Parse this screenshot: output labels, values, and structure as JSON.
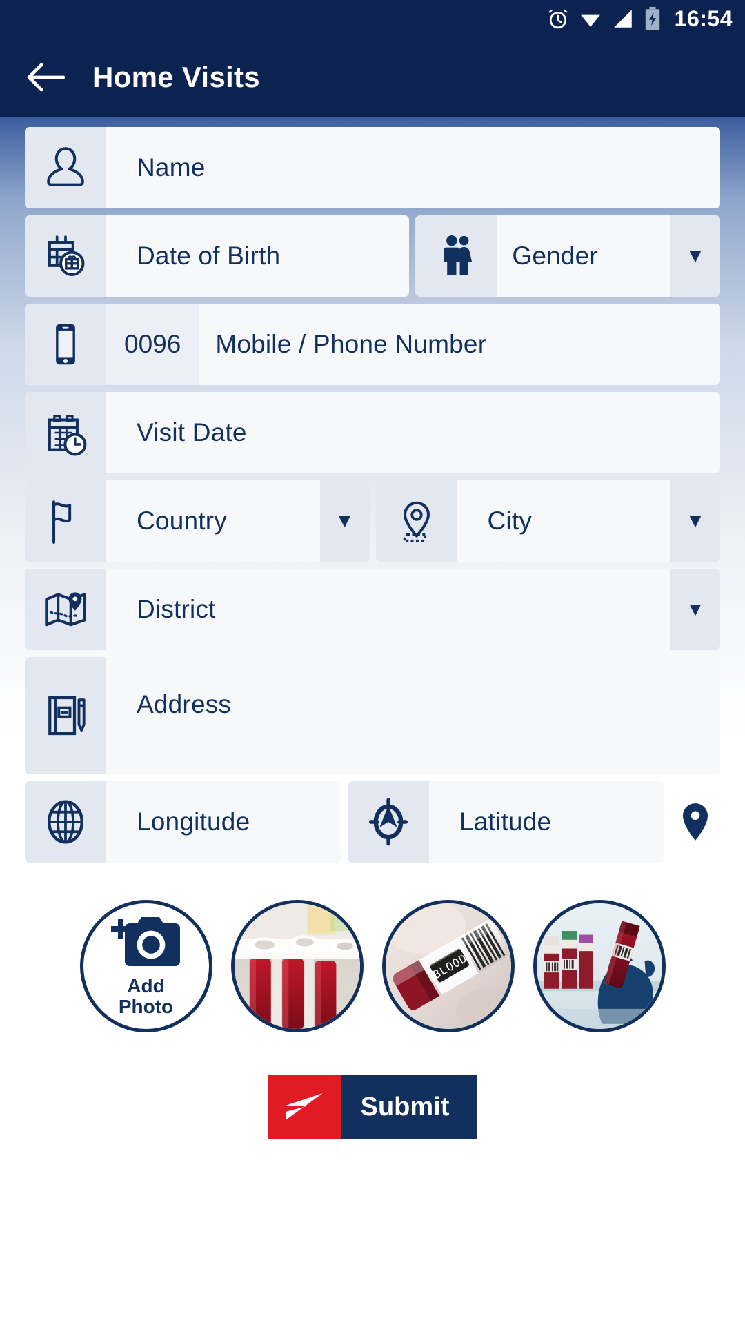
{
  "status_bar": {
    "time": "16:54",
    "icons": [
      "alarm-clock-icon",
      "wifi-icon",
      "cellular-signal-icon",
      "battery-charging-icon"
    ]
  },
  "app_bar": {
    "back_icon": "back-arrow-icon",
    "title": "Home Visits"
  },
  "form": {
    "fields": [
      {
        "key": "name",
        "label": "Name",
        "icon": "person-icon"
      },
      {
        "key": "dob",
        "label": "Date of Birth",
        "icon": "calendar-birthday-icon"
      },
      {
        "key": "gender",
        "label": "Gender",
        "icon": "gender-icon",
        "caret": "▼"
      },
      {
        "key": "phone",
        "label": "Mobile / Phone Number",
        "icon": "mobile-phone-icon",
        "prefix": "0096"
      },
      {
        "key": "visit_date",
        "label": "Visit Date",
        "icon": "calendar-clock-icon"
      },
      {
        "key": "country",
        "label": "Country",
        "icon": "flag-icon",
        "caret": "▼"
      },
      {
        "key": "city",
        "label": "City",
        "icon": "map-pin-icon",
        "caret": "▼"
      },
      {
        "key": "district",
        "label": "District",
        "icon": "map-location-icon",
        "caret": "▼"
      },
      {
        "key": "address",
        "label": "Address",
        "icon": "notebook-pencil-icon"
      },
      {
        "key": "longitude",
        "label": "Longitude",
        "icon": "globe-icon"
      },
      {
        "key": "latitude",
        "label": "Latitude",
        "icon": "compass-icon",
        "trailing_icon": "location-pin-icon"
      }
    ]
  },
  "photos": {
    "add_photo": {
      "icon": "add-camera-icon",
      "label_line1": "Add",
      "label_line2": "Photo"
    },
    "thumbnails": [
      {
        "name": "blood-sample-tubes-rack-photo"
      },
      {
        "name": "blood-vial-labeled-photo",
        "label": "BLOOD"
      },
      {
        "name": "blood-tubes-gloved-hand-photo"
      }
    ]
  },
  "submit": {
    "label": "Submit",
    "icon": "send-plane-icon",
    "icon_color": "#e01b24",
    "label_color": "#12305e"
  },
  "theme": {
    "navy": "#0c2352",
    "field_icon_bg": "#e2e7f0",
    "field_bg": "#f7f8fa",
    "text_navy": "#12305e",
    "accent_red": "#e01b24"
  }
}
